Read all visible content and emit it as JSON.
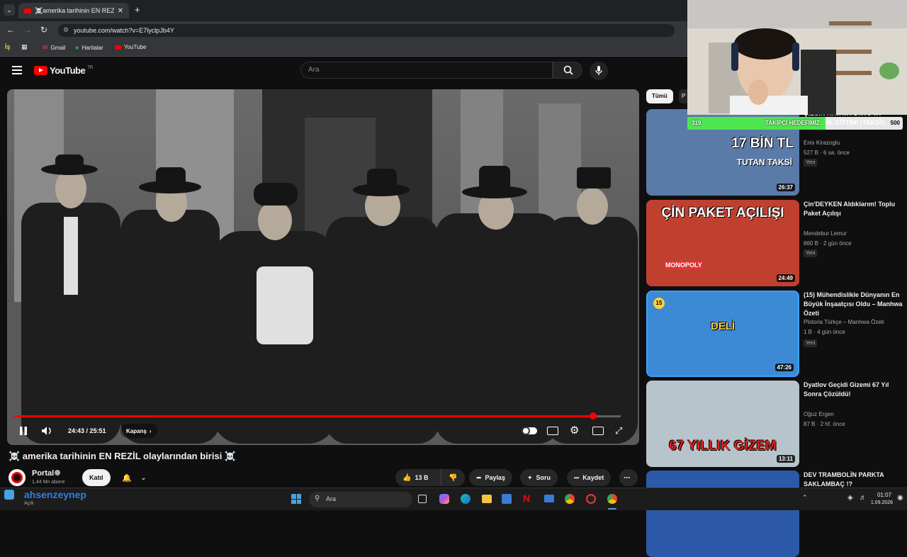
{
  "browser": {
    "tab_title": "☠️amerika tarihinin EN REZ...",
    "url": "youtube.com/watch?v=E7lyclpJb4Y",
    "bookmarks": [
      "Gmail",
      "Haritalar",
      "YouTube"
    ]
  },
  "youtube": {
    "logo": "YouTube",
    "region": "TR",
    "search_placeholder": "Ara",
    "player": {
      "time": "24:43 / 25:51",
      "chapter": "Kapanş",
      "progress_fraction": 0.955
    },
    "video": {
      "title": "☠️ amerika tarihinin EN REZİL olaylarından birisi ☠️",
      "channel": "Portal",
      "subscribers": "1,44 Mn abone",
      "join": "Katıl",
      "likes": "13 B",
      "share": "Paylaş",
      "ask": "Soru",
      "save": "Kaydet"
    },
    "chips": [
      "Tümü",
      "P"
    ],
    "recommendations": [
      {
        "title": "ÇILGIN HAYATA GTA 6'YA FİNALINE GİTTİM! (TAKSİY...",
        "channel": "Enis Kirazoglu",
        "meta": "527 B · 6 sa. önce",
        "badge": "Yeni",
        "duration": "26:37",
        "thumb_text": "17 BİN TL",
        "thumb_sub": "TUTAN TAKSİ",
        "thumb_color": "#5a7aa8"
      },
      {
        "title": "Çin'DEYKEN Aldıklarım! Toplu Paket Açılışı",
        "channel": "Mendebur Lemur",
        "meta": "860 B · 2 gün önce",
        "badge": "Yeni",
        "duration": "24:49",
        "thumb_text": "ÇİN PAKET AÇILIŞI",
        "thumb_sub": "MONOPOLY",
        "thumb_color": "#c04030"
      },
      {
        "title": "(15) Mühendislikle Dünyanın En Büyük İnşaatçısı Oldu – Manhwa Özeti",
        "channel": "Plotoria Türkçe – Manhwa Özeti",
        "meta": "1 B · 4 gün önce",
        "badge": "Yeni",
        "duration": "47:26",
        "thumb_text": "DELİ",
        "thumb_sub": "15",
        "thumb_color": "#3d8ad4"
      },
      {
        "title": "Dyatlov Geçidi Gizemi 67 Yıl Sonra Çözüldü!",
        "channel": "Oğuz Ergen",
        "meta": "87 B · 2 hf. önce",
        "badge": "",
        "duration": "13:11",
        "thumb_text": "67 YILLIK GİZEM",
        "thumb_sub": "",
        "thumb_color": "#b8c4cc"
      },
      {
        "title": "DEV TRAMBOLİN PARKTA SAKLAMBAÇ !?",
        "channel": "",
        "meta": "",
        "badge": "",
        "duration": "",
        "thumb_text": "",
        "thumb_sub": "",
        "thumb_color": "#2c5aa8"
      }
    ]
  },
  "overlay": {
    "goal_label": "TAKİPÇİ HEDEFİMİZ",
    "goal_current": "319",
    "goal_target": "500",
    "goal_fraction": 0.64,
    "goal_text_behind": "ÇILGIN HAYATA GTA 6'YA FİFA DÜNYA KUPASI"
  },
  "taskbar": {
    "user": "ahsenzeynep",
    "status": "Açık",
    "search": "Ara",
    "time": "01:07",
    "date": "1.09.2026"
  }
}
